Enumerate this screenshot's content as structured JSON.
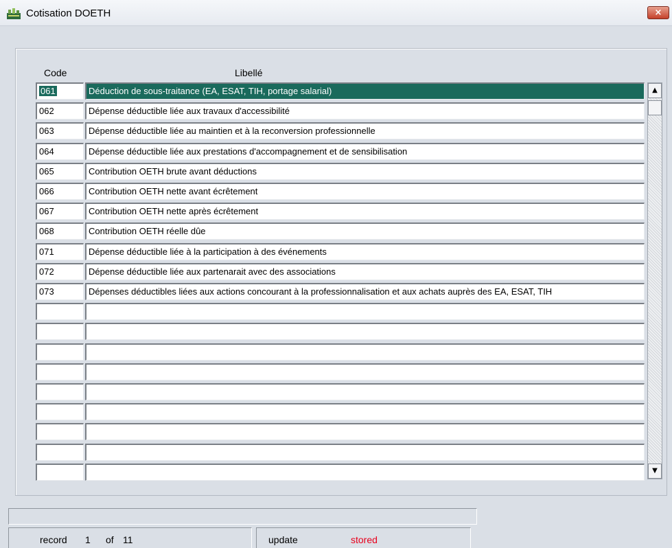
{
  "window": {
    "title": "Cotisation DOETH",
    "close_label": "×"
  },
  "table": {
    "headers": {
      "code": "Code",
      "label": "Libellé"
    },
    "selected_index": 0,
    "rows": [
      {
        "code": "061",
        "label": "Déduction de sous-traitance (EA, ESAT, TIH, portage salarial)"
      },
      {
        "code": "062",
        "label": "Dépense déductible liée aux travaux d'accessibilité"
      },
      {
        "code": "063",
        "label": "Dépense déductible liée au maintien et à la reconversion professionnelle"
      },
      {
        "code": "064",
        "label": "Dépense déductible liée aux prestations d'accompagnement et de sensibilisation"
      },
      {
        "code": "065",
        "label": "Contribution OETH brute avant déductions"
      },
      {
        "code": "066",
        "label": "Contribution OETH nette avant écrêtement"
      },
      {
        "code": "067",
        "label": "Contribution OETH nette après écrêtement"
      },
      {
        "code": "068",
        "label": "Contribution OETH réelle dûe"
      },
      {
        "code": "071",
        "label": "Dépense déductible liée à la participation à des événements"
      },
      {
        "code": "072",
        "label": "Dépense déductible liée aux partenarait avec des associations"
      },
      {
        "code": "073",
        "label": "Dépenses déductibles liées aux actions concourant à la professionnalisation et aux achats auprès des EA, ESAT, TIH"
      },
      {
        "code": "",
        "label": ""
      },
      {
        "code": "",
        "label": ""
      },
      {
        "code": "",
        "label": ""
      },
      {
        "code": "",
        "label": ""
      },
      {
        "code": "",
        "label": ""
      },
      {
        "code": "",
        "label": ""
      },
      {
        "code": "",
        "label": ""
      },
      {
        "code": "",
        "label": ""
      },
      {
        "code": "",
        "label": ""
      }
    ]
  },
  "scrollbar": {
    "up_icon": "▲",
    "down_icon": "▼"
  },
  "status": {
    "message": "",
    "record_label": "record",
    "record_current": "1",
    "record_of": "of",
    "record_total": "11",
    "update_label": "update",
    "update_state": "stored"
  },
  "colors": {
    "selection": "#1a6a5c",
    "stored_text": "#e8001c"
  }
}
